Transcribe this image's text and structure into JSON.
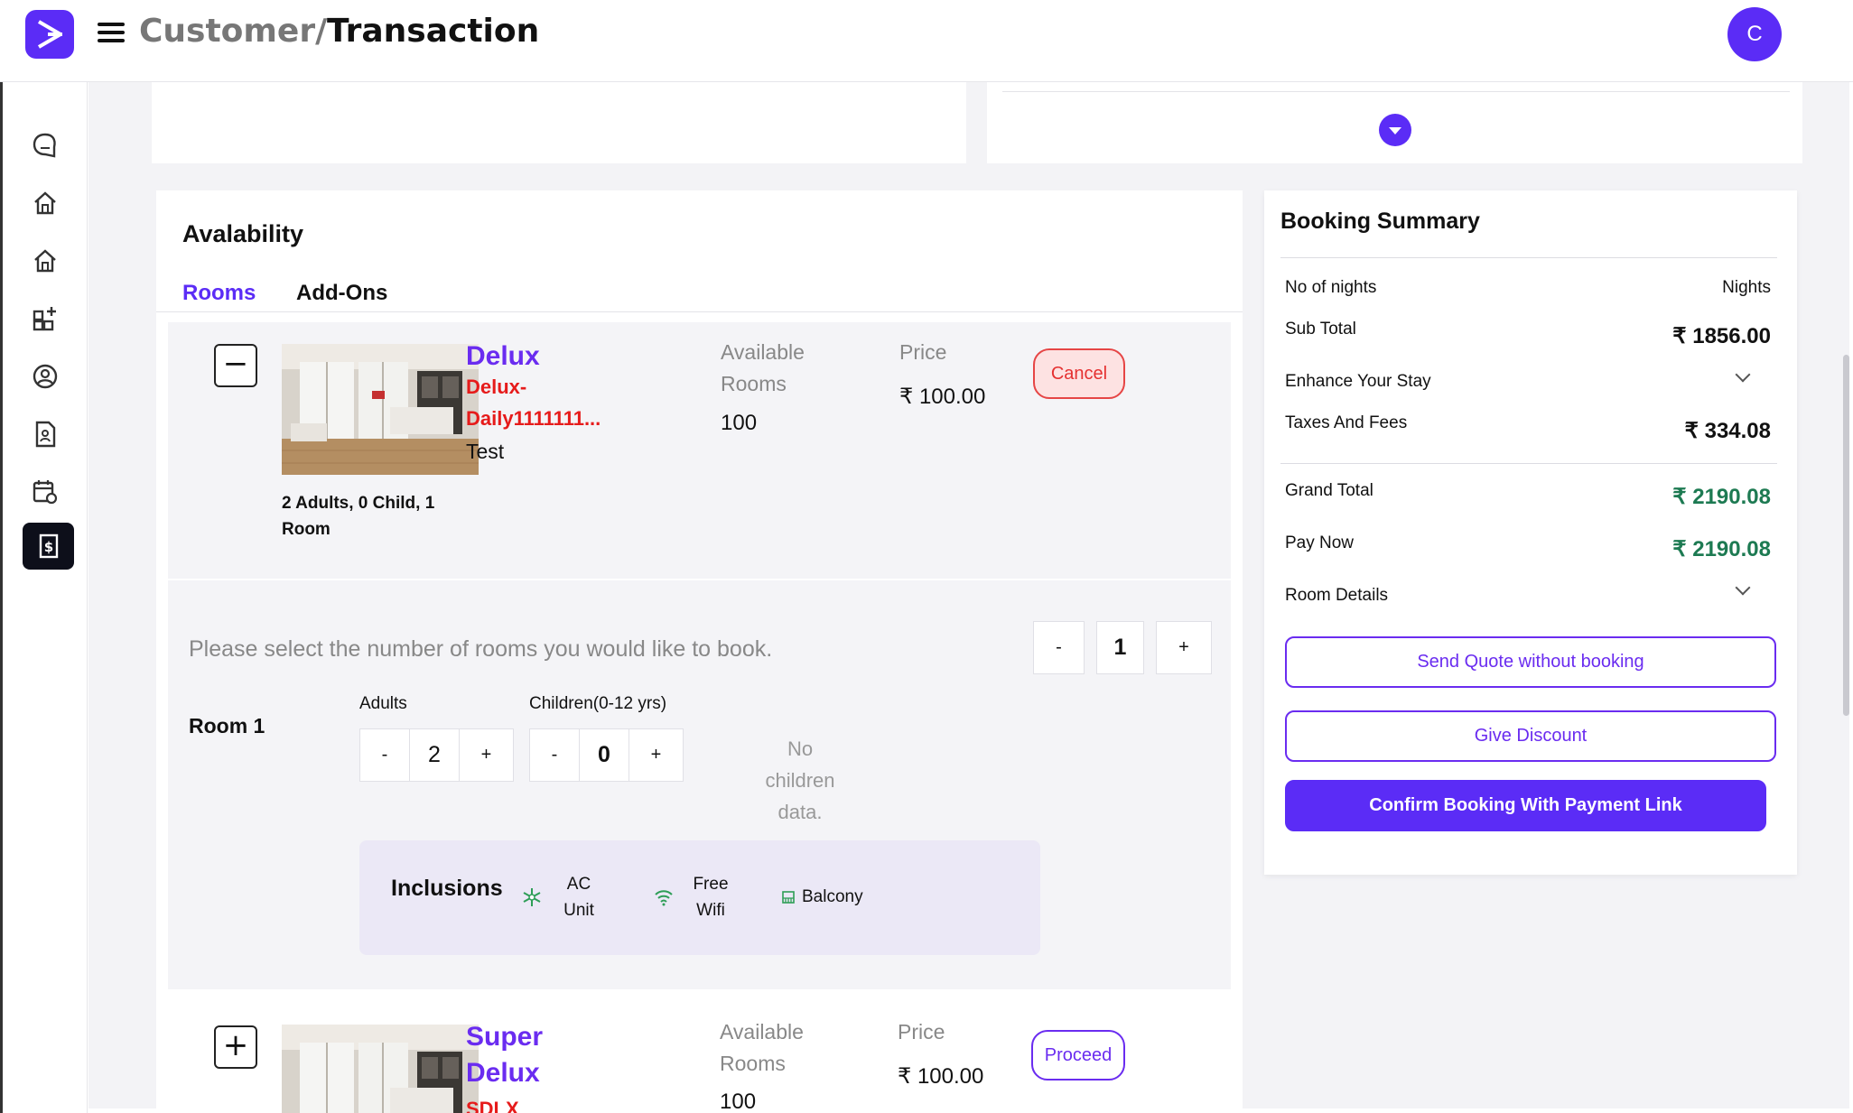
{
  "header": {
    "breadcrumb_parent": "Customer/",
    "breadcrumb_current": "Transaction",
    "avatar_initial": "C"
  },
  "sidebar": {
    "items": [
      {
        "icon": "chat-icon"
      },
      {
        "icon": "home-icon"
      },
      {
        "icon": "home-outline-icon"
      },
      {
        "icon": "add-grid-icon"
      },
      {
        "icon": "user-circle-icon"
      },
      {
        "icon": "contact-document-icon"
      },
      {
        "icon": "calendar-settings-icon"
      },
      {
        "icon": "invoice-dollar-icon",
        "active": true
      }
    ]
  },
  "availability": {
    "title": "Avalability",
    "tabs": [
      "Rooms",
      "Add-Ons"
    ],
    "rooms": [
      {
        "toggle": "−",
        "name": "Delux",
        "code": "Delux-Daily1111111...",
        "description": "Test",
        "guests": "2 Adults, 0 Child, 1 Room",
        "available_label": "Available Rooms",
        "available_value": "100",
        "price_label": "Price",
        "price_value": "₹ 100.00",
        "action": "Cancel"
      },
      {
        "toggle": "+",
        "name": "Super Delux",
        "code": "SDLX",
        "available_label": "Available Rooms",
        "available_value": "100",
        "price_label": "Price",
        "price_value": "₹ 100.00",
        "action": "Proceed"
      }
    ],
    "select_prompt": "Please select the number of rooms you would like to book.",
    "room_count": {
      "minus": "-",
      "value": "1",
      "plus": "+"
    },
    "room_label": "Room 1",
    "adults": {
      "label": "Adults",
      "minus": "-",
      "value": "2",
      "plus": "+"
    },
    "children": {
      "label": "Children(0-12 yrs)",
      "minus": "-",
      "value": "0",
      "plus": "+"
    },
    "no_children": "No children data.",
    "inclusions": {
      "title": "Inclusions",
      "items": [
        {
          "icon": "snowflake-icon",
          "label": "AC Unit"
        },
        {
          "icon": "wifi-icon",
          "label": "Free Wifi"
        },
        {
          "icon": "balcony-icon",
          "label": "Balcony"
        }
      ]
    }
  },
  "summary": {
    "title": "Booking Summary",
    "no_of_nights_label": "No of nights",
    "no_of_nights_value": "Nights",
    "subtotal_label": "Sub Total",
    "subtotal_value": "₹ 1856.00",
    "enhance_label": "Enhance Your Stay",
    "taxes_label": "Taxes And Fees",
    "taxes_value": "₹ 334.08",
    "grand_total_label": "Grand Total",
    "grand_total_value": "₹ 2190.08",
    "pay_now_label": "Pay Now",
    "pay_now_value": "₹ 2190.08",
    "room_details_label": "Room Details",
    "send_quote": "Send Quote without booking",
    "give_discount": "Give Discount",
    "confirm": "Confirm Booking With Payment Link",
    "value_color": "#1d7a52"
  },
  "colors": {
    "accent": "#5b2cf6",
    "danger": "#e53030"
  }
}
